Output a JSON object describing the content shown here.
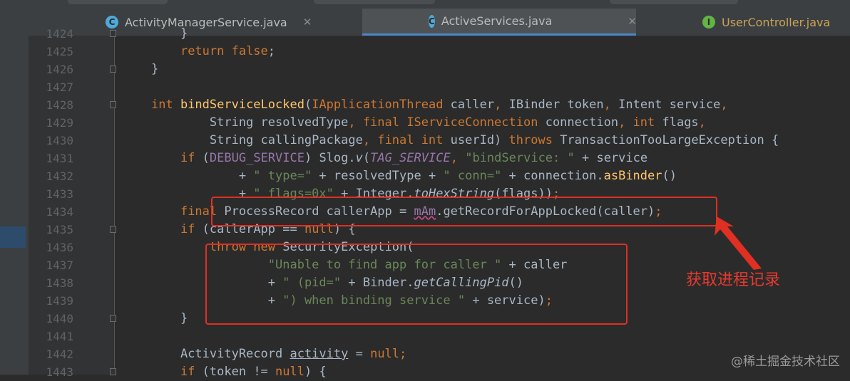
{
  "tabs": [
    {
      "label": "ActivityManagerService.java",
      "icon": "C",
      "closable": true,
      "active": false
    },
    {
      "label": "ActiveServices.java",
      "icon": "C",
      "closable": true,
      "active": true
    },
    {
      "label": "UserController.java",
      "icon": "I",
      "closable": false,
      "active": false
    }
  ],
  "editor": {
    "lines": [
      {
        "num": "1424",
        "html": "    <span>}</span>"
      },
      {
        "num": "1425",
        "html": "    <span class='kw'>return false</span>;"
      },
      {
        "num": "1426",
        "html": "}"
      },
      {
        "num": "1427",
        "html": ""
      },
      {
        "num": "1428",
        "html": "<span class='kw'>int </span><span class='fn'>bindServiceLocked</span>(<span class='kw'>IApplicationThread </span>caller<span class='kw'>, </span>IBinder token<span class='kw'>, </span>Intent service<span class='kw'>,</span>"
      },
      {
        "num": "1429",
        "html": "        String resolvedType<span class='kw'>, final </span><span class='kw'>IServiceConnection </span>connection<span class='kw'>, int </span>flags<span class='kw'>,</span>"
      },
      {
        "num": "1430",
        "html": "        String callingPackage<span class='kw'>, final int </span>userId) <span class='kw'>throws </span>TransactionTooLargeException {"
      },
      {
        "num": "1431",
        "html": "    <span class='kw'>if </span>(<span class='cn'>DEBUG_SERVICE</span>) Slog.<span class='it'>v</span>(<span class='cnit'>TAG_SERVICE</span><span class='kw'>, </span><span class='st'>\"bindService: \" </span>+ service"
      },
      {
        "num": "1432",
        "html": "            + <span class='st'>\" type=\" </span>+ resolvedType + <span class='st'>\" conn=\" </span>+ connection.<span class='fn'>asBinder</span>()"
      },
      {
        "num": "1433",
        "html": "            + <span class='st'>\" flags=0x\" </span>+ Integer.<span class='it'>toHexString</span>(flags))<span class='kw'>;</span>"
      },
      {
        "num": "1434",
        "html": "    <span class='kw'>final </span>ProcessRecord callerApp = <span class='cn wavy'>mAm</span>.getRecordForAppLocked(caller)<span class='kw'>;</span>"
      },
      {
        "num": "1435",
        "html": "    <span class='kw'>if </span>(callerApp == <span class='kw'>null</span>) {"
      },
      {
        "num": "1436",
        "html": "        <span class='kw'>throw new </span>SecurityException("
      },
      {
        "num": "1437",
        "html": "                <span class='st'>\"Unable to find app for caller \" </span>+ caller"
      },
      {
        "num": "1438",
        "html": "                + <span class='st'>\" (pid=\" </span>+ Binder.<span class='it'>getCallingPid</span>()"
      },
      {
        "num": "1439",
        "html": "                + <span class='st'>\") when binding service \" </span>+ service)<span class='kw'>;</span>"
      },
      {
        "num": "1440",
        "html": "    }"
      },
      {
        "num": "1441",
        "html": ""
      },
      {
        "num": "1442",
        "html": "    ActivityRecord <span class='ul'>activity</span> = <span class='kw'>null</span><span class='kw'>;</span>"
      },
      {
        "num": "1443",
        "html": "    <span class='kw'>if </span>(token != <span class='kw'>null</span>) {"
      }
    ]
  },
  "annotation": {
    "text": "获取进程记录",
    "color": "#e02f23"
  },
  "watermark": {
    "text": "@稀土掘金技术社区"
  },
  "colors": {
    "keyword": "#cc7832",
    "method": "#ffc66d",
    "string": "#6a8759",
    "constant": "#9876aa",
    "text": "#a9b7c6",
    "background": "#2b2b2b"
  }
}
